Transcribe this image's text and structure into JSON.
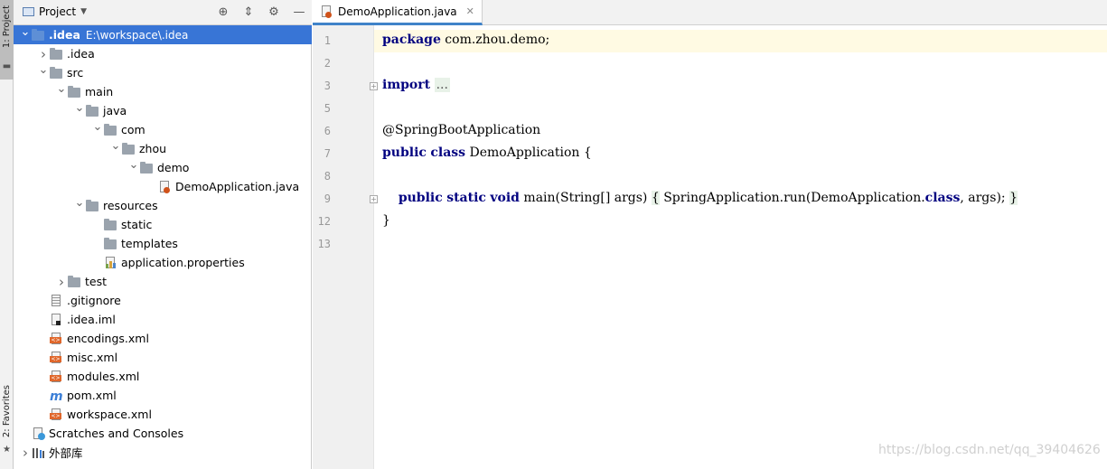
{
  "tool_strip": {
    "project_tab": "1: Project",
    "favorites_tab": "2: Favorites"
  },
  "project_panel": {
    "title": "Project",
    "tree": [
      {
        "label": ".idea",
        "secondary": "E:\\workspace\\.idea",
        "icon": "module-folder-icon",
        "expanded": true,
        "selected": true
      },
      {
        "label": ".idea",
        "icon": "folder-icon",
        "expanded": false
      },
      {
        "label": "src",
        "icon": "folder-icon",
        "expanded": true
      },
      {
        "label": "main",
        "icon": "folder-icon",
        "expanded": true
      },
      {
        "label": "java",
        "icon": "folder-icon",
        "expanded": true
      },
      {
        "label": "com",
        "icon": "folder-icon",
        "expanded": true
      },
      {
        "label": "zhou",
        "icon": "folder-icon",
        "expanded": true
      },
      {
        "label": "demo",
        "icon": "folder-icon",
        "expanded": true
      },
      {
        "label": "DemoApplication.java",
        "icon": "java-file-icon"
      },
      {
        "label": "resources",
        "icon": "folder-icon",
        "expanded": true
      },
      {
        "label": "static",
        "icon": "folder-icon"
      },
      {
        "label": "templates",
        "icon": "folder-icon"
      },
      {
        "label": "application.properties",
        "icon": "properties-file-icon"
      },
      {
        "label": "test",
        "icon": "folder-icon",
        "expanded": false
      },
      {
        "label": ".gitignore",
        "icon": "text-file-icon"
      },
      {
        "label": ".idea.iml",
        "icon": "iml-file-icon"
      },
      {
        "label": "encodings.xml",
        "icon": "xml-file-icon"
      },
      {
        "label": "misc.xml",
        "icon": "xml-file-icon"
      },
      {
        "label": "modules.xml",
        "icon": "xml-file-icon"
      },
      {
        "label": "pom.xml",
        "icon": "maven-icon"
      },
      {
        "label": "workspace.xml",
        "icon": "xml-file-icon"
      },
      {
        "label": "Scratches and Consoles",
        "icon": "scratches-icon"
      },
      {
        "label": "外部库",
        "icon": "libraries-icon",
        "expanded": false
      }
    ]
  },
  "editor": {
    "tab_label": "DemoApplication.java",
    "lines": [
      {
        "num": "1",
        "tokens": [
          {
            "t": "package",
            "k": "kw"
          },
          {
            "t": " com.zhou.demo;"
          }
        ]
      },
      {
        "num": "2",
        "tokens": []
      },
      {
        "num": "3",
        "tokens": [
          {
            "t": "import",
            "k": "kw"
          },
          {
            "t": " "
          },
          {
            "t": "...",
            "k": "folded"
          }
        ]
      },
      {
        "num": "5",
        "tokens": []
      },
      {
        "num": "6",
        "tokens": [
          {
            "t": "@SpringBootApplication"
          }
        ]
      },
      {
        "num": "7",
        "tokens": [
          {
            "t": "public",
            "k": "kw"
          },
          {
            "t": " "
          },
          {
            "t": "class",
            "k": "kw"
          },
          {
            "t": " DemoApplication {"
          }
        ]
      },
      {
        "num": "8",
        "tokens": []
      },
      {
        "num": "9",
        "tokens": [
          {
            "t": "    "
          },
          {
            "t": "public",
            "k": "kw"
          },
          {
            "t": " "
          },
          {
            "t": "static",
            "k": "kw"
          },
          {
            "t": " "
          },
          {
            "t": "void",
            "k": "kw"
          },
          {
            "t": " main(String[] args) "
          },
          {
            "t": "{",
            "k": "folded-brace"
          },
          {
            "t": " SpringApplication.run(DemoApplication."
          },
          {
            "t": "class",
            "k": "kw"
          },
          {
            "t": ", args); "
          },
          {
            "t": "}",
            "k": "folded-brace"
          }
        ]
      },
      {
        "num": "12",
        "tokens": [
          {
            "t": "}"
          }
        ]
      },
      {
        "num": "13",
        "tokens": []
      }
    ]
  },
  "watermark": "https://blog.csdn.net/qq_39404626"
}
